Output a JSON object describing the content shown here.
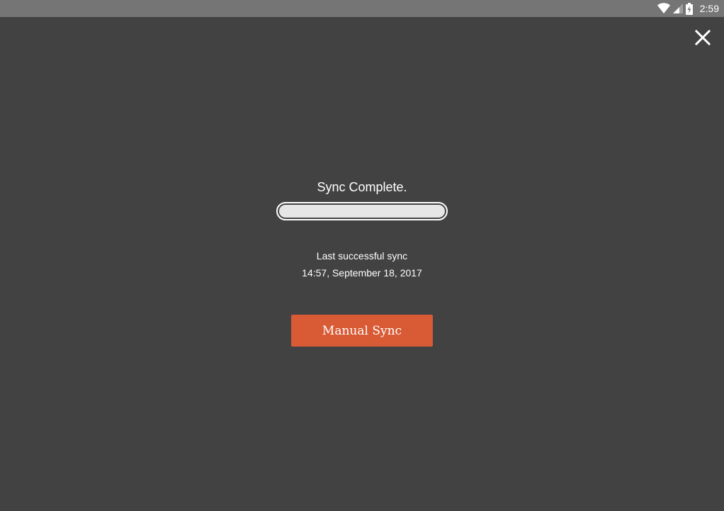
{
  "status_bar": {
    "time": "2:59",
    "icons": [
      "wifi-icon",
      "signal-icon",
      "battery-charging-icon"
    ]
  },
  "close": {
    "icon": "close-icon"
  },
  "sync": {
    "status_text": "Sync Complete.",
    "progress": 1.0,
    "last_sync_label": "Last successful sync",
    "last_sync_time": "14:57, September 18, 2017",
    "manual_sync_label": "Manual Sync"
  },
  "colors": {
    "background": "#424242",
    "status_bar": "#757575",
    "button": "#d95b35",
    "progress_fill": "#e6e6e6"
  }
}
